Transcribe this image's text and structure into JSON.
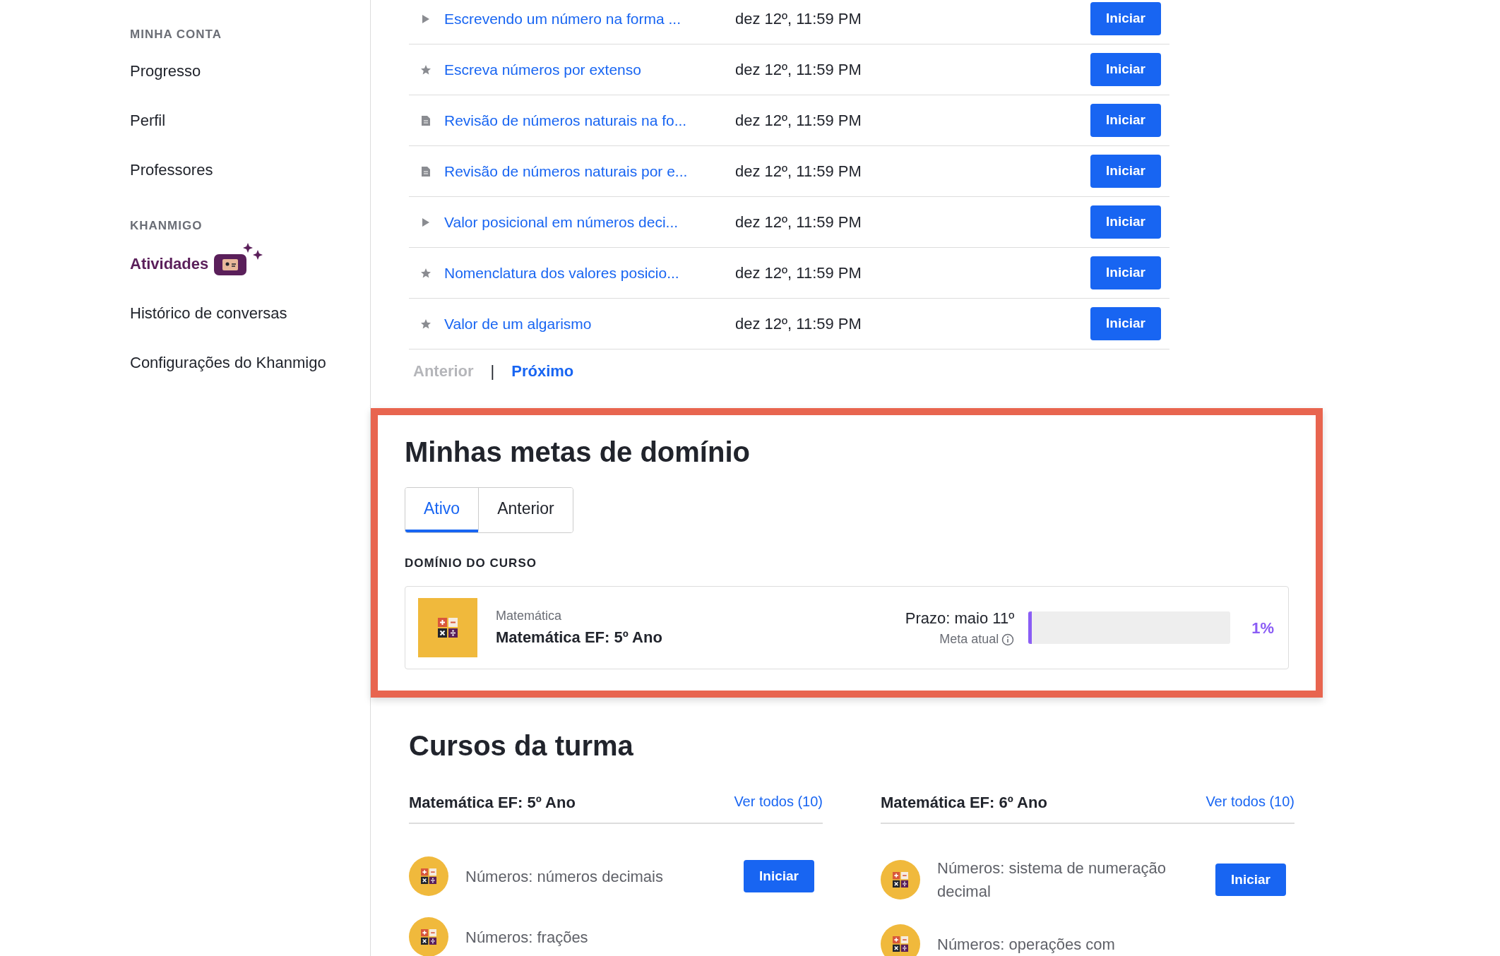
{
  "sidebar": {
    "sections": [
      {
        "heading": "MINHA CONTA",
        "items": [
          {
            "label": "Progresso",
            "selected": false,
            "badge": false
          },
          {
            "label": "Perfil",
            "selected": false,
            "badge": false
          },
          {
            "label": "Professores",
            "selected": false,
            "badge": false
          }
        ]
      },
      {
        "heading": "KHANMIGO",
        "items": [
          {
            "label": "Atividades",
            "selected": true,
            "badge": true
          },
          {
            "label": "Histórico de conversas",
            "selected": false,
            "badge": false
          },
          {
            "label": "Configurações do Khanmigo",
            "selected": false,
            "badge": false
          }
        ]
      }
    ]
  },
  "assignments": {
    "rows": [
      {
        "kind": "video",
        "title": "Escrevendo um número na forma ...",
        "due": "dez 12º, 11:59 PM",
        "button": "Iniciar"
      },
      {
        "kind": "exercise",
        "title": "Escreva números por extenso",
        "due": "dez 12º, 11:59 PM",
        "button": "Iniciar"
      },
      {
        "kind": "article",
        "title": "Revisão de números naturais na fo...",
        "due": "dez 12º, 11:59 PM",
        "button": "Iniciar"
      },
      {
        "kind": "article",
        "title": "Revisão de números naturais por e...",
        "due": "dez 12º, 11:59 PM",
        "button": "Iniciar"
      },
      {
        "kind": "video",
        "title": "Valor posicional em números deci...",
        "due": "dez 12º, 11:59 PM",
        "button": "Iniciar"
      },
      {
        "kind": "exercise",
        "title": "Nomenclatura dos valores posicio...",
        "due": "dez 12º, 11:59 PM",
        "button": "Iniciar"
      },
      {
        "kind": "exercise",
        "title": "Valor de um algarismo",
        "due": "dez 12º, 11:59 PM",
        "button": "Iniciar"
      }
    ],
    "pagination": {
      "separator": "|",
      "previous": {
        "label": "Anterior",
        "disabled": true
      },
      "next": {
        "label": "Próximo",
        "disabled": false
      }
    }
  },
  "mastery_goals": {
    "title": "Minhas metas de domínio",
    "tabs": [
      {
        "label": "Ativo",
        "selected": true
      },
      {
        "label": "Anterior",
        "selected": false
      }
    ],
    "section_label": "DOMÍNIO DO CURSO",
    "goal": {
      "subject": "Matemática",
      "course": "Matemática EF: 5º Ano",
      "deadline": "Prazo: maio 11º",
      "meta_label": "Meta atual",
      "level": 0.01,
      "percent": "1%"
    }
  },
  "class_courses": {
    "title": "Cursos da turma",
    "courses": [
      {
        "name": "Matemática EF: 5º Ano",
        "link": "Ver todos (10)",
        "units": [
          {
            "title": "Números: números decimais",
            "button": "Iniciar"
          },
          {
            "title": "Números: frações"
          }
        ]
      },
      {
        "name": "Matemática EF: 6º Ano",
        "link": "Ver todos (10)",
        "units": [
          {
            "title": "Números: sistema de numeração decimal",
            "button": "Iniciar"
          },
          {
            "title": "Números: operações com"
          }
        ]
      }
    ]
  }
}
